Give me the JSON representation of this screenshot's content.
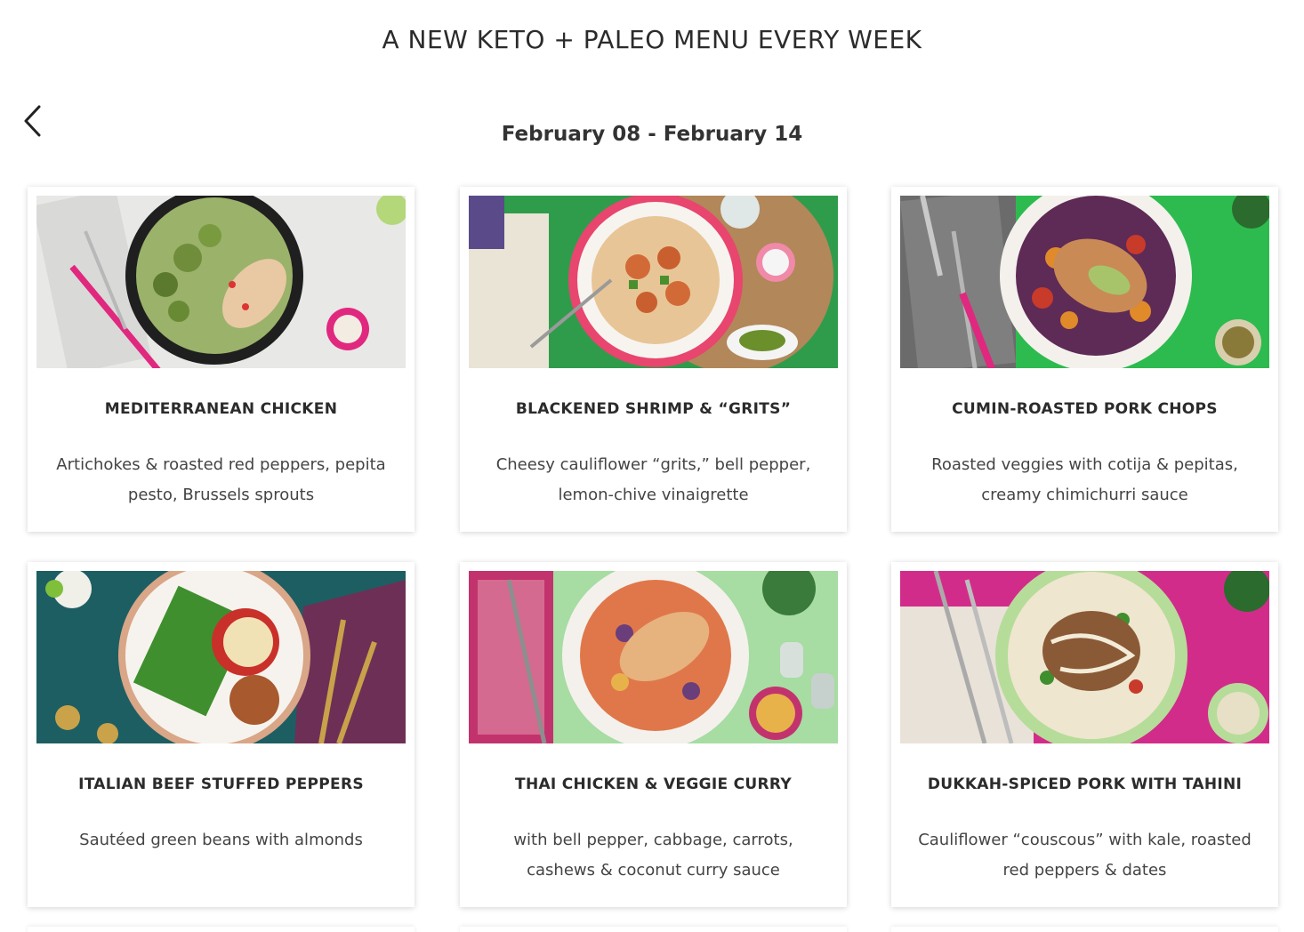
{
  "header": {
    "title": "A NEW KETO + PALEO MENU EVERY WEEK",
    "week_range": "February 08 - February 14",
    "back_icon": "chevron-left-icon"
  },
  "meals": [
    {
      "title": "MEDITERRANEAN CHICKEN",
      "description": "Artichokes & roasted red peppers, pepita pesto, Brussels sprouts",
      "bg": "#e9e9e7",
      "accent": "#e0287f"
    },
    {
      "title": "BLACKENED SHRIMP & “GRITS”",
      "description": "Cheesy cauliflower “grits,” bell pepper, lemon-chive vinaigrette",
      "bg": "#2fa84f",
      "accent": "#e8456f"
    },
    {
      "title": "CUMIN-ROASTED PORK CHOPS",
      "description": "Roasted veggies with cotija & pepitas, creamy chimichurri sauce",
      "bg": "#2dbb4f",
      "accent": "#e0287f"
    },
    {
      "title": "ITALIAN BEEF STUFFED PEPPERS",
      "description": "Sautéed green beans with almonds",
      "bg": "#1d5e63",
      "accent": "#c8a24a"
    },
    {
      "title": "THAI CHICKEN & VEGGIE CURRY",
      "description": "with bell pepper, cabbage, carrots, cashews & coconut curry sauce",
      "bg": "#a7dca3",
      "accent": "#c2336e"
    },
    {
      "title": "DUKKAH-SPICED PORK WITH TAHINI",
      "description": "Cauliflower “couscous” with kale, roasted red peppers & dates",
      "bg": "#d22c8a",
      "accent": "#9ccf8e"
    }
  ]
}
